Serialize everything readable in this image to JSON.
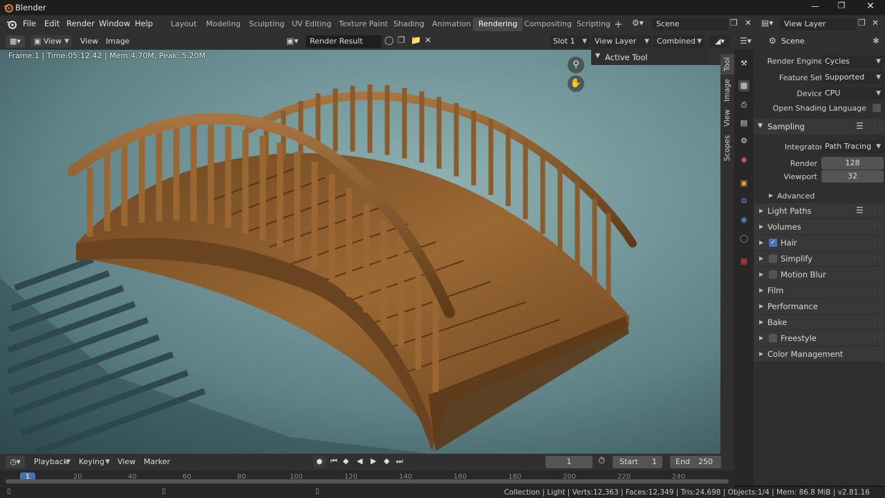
{
  "app": {
    "title": "Blender",
    "version": "v2.81.16"
  },
  "menu": [
    "File",
    "Edit",
    "Render",
    "Window",
    "Help"
  ],
  "workspaces": [
    "Layout",
    "Modeling",
    "Sculpting",
    "UV Editing",
    "Texture Paint",
    "Shading",
    "Animation",
    "Rendering",
    "Compositing",
    "Scripting"
  ],
  "active_workspace": "Rendering",
  "scene": {
    "name": "Scene",
    "view_layer": "View Layer"
  },
  "image_editor": {
    "view_menu": "View",
    "menus": [
      "View",
      "Image"
    ],
    "image_name": "Render Result",
    "slot": "Slot 1",
    "layer": "View Layer",
    "pass": "Combined",
    "render_info": "Frame:1 | Time:05:12.42 | Mem:4.70M, Peak: 5.20M"
  },
  "npanel": {
    "active_tool_title": "Active Tool",
    "tabs": [
      "Tool",
      "Image",
      "View",
      "Scopes"
    ]
  },
  "properties": {
    "context": "Scene",
    "render_engine_label": "Render Engine",
    "render_engine": "Cycles",
    "feature_set_label": "Feature Set",
    "feature_set": "Supported",
    "device_label": "Device",
    "device": "CPU",
    "osl_label": "Open Shading Language",
    "osl_checked": false,
    "sampling": {
      "title": "Sampling",
      "integrator_label": "Integrator",
      "integrator": "Path Tracing",
      "render_label": "Render",
      "render": "128",
      "viewport_label": "Viewport",
      "viewport": "32",
      "advanced": "Advanced"
    },
    "panels": [
      {
        "label": "Light Paths",
        "checkbox": null
      },
      {
        "label": "Volumes",
        "checkbox": null
      },
      {
        "label": "Hair",
        "checkbox": true
      },
      {
        "label": "Simplify",
        "checkbox": false
      },
      {
        "label": "Motion Blur",
        "checkbox": false
      },
      {
        "label": "Film",
        "checkbox": null
      },
      {
        "label": "Performance",
        "checkbox": null
      },
      {
        "label": "Bake",
        "checkbox": null
      },
      {
        "label": "Freestyle",
        "checkbox": false
      },
      {
        "label": "Color Management",
        "checkbox": null
      }
    ]
  },
  "timeline": {
    "menus": [
      "Playback",
      "Keying",
      "View",
      "Marker"
    ],
    "current_frame": "1",
    "start_label": "Start",
    "start": "1",
    "end_label": "End",
    "end": "250",
    "ruler": [
      "1",
      "20",
      "40",
      "60",
      "80",
      "100",
      "120",
      "140",
      "160",
      "180",
      "200",
      "220",
      "240"
    ]
  },
  "status": "Collection | Light | Verts:12,363 | Faces:12,349 | Tris:24,698 | Objects:1/4 | Mem: 86.8 MiB | v2.81.16",
  "colors": {
    "accent": "#4772b3",
    "active_frame": "#4772b3",
    "viewport_bg": "#4d6d72",
    "wood": "#8a5a2b"
  }
}
